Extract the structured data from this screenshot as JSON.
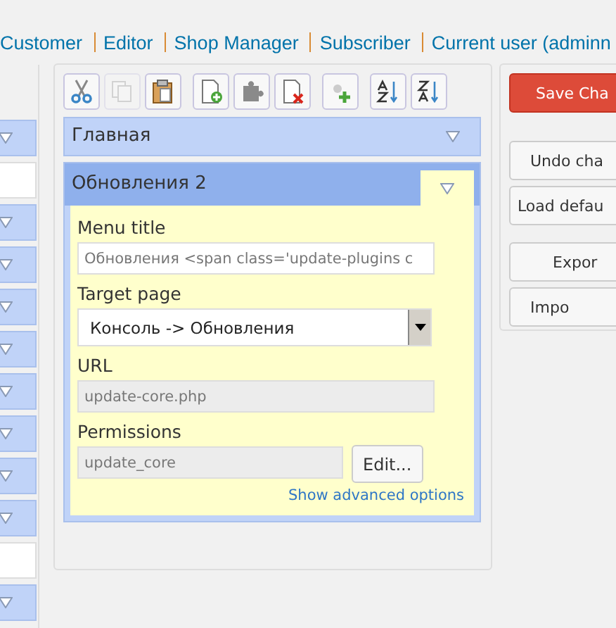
{
  "role_links": [
    {
      "label": "Customer"
    },
    {
      "label": "Editor"
    },
    {
      "label": "Shop Manager"
    },
    {
      "label": "Subscriber"
    },
    {
      "label": "Current user (adminn"
    }
  ],
  "left_menu": {
    "items": [
      {
        "kind": "menu"
      },
      {
        "kind": "separator"
      },
      {
        "kind": "menu"
      },
      {
        "kind": "menu"
      },
      {
        "kind": "menu"
      },
      {
        "kind": "menu"
      },
      {
        "kind": "menu"
      },
      {
        "kind": "menu"
      },
      {
        "kind": "menu"
      },
      {
        "kind": "menu"
      },
      {
        "kind": "separator"
      },
      {
        "kind": "menu"
      }
    ]
  },
  "toolbar": [
    {
      "kind": "cut",
      "disabled": false
    },
    {
      "kind": "copy",
      "disabled": true
    },
    {
      "kind": "paste",
      "disabled": false
    },
    {
      "kind": "new-menu",
      "disabled": false
    },
    {
      "kind": "plugin",
      "disabled": false
    },
    {
      "kind": "delete",
      "disabled": false
    },
    {
      "kind": "separator",
      "disabled": false
    },
    {
      "kind": "sort-asc",
      "disabled": false
    },
    {
      "kind": "sort-desc",
      "disabled": false
    }
  ],
  "menu_items": [
    {
      "title": "Главная",
      "expanded": false
    },
    {
      "title": "Обновления 2",
      "expanded": true,
      "fields": [
        {
          "kind": "text",
          "label": "Menu title",
          "value": "Обновления <span class='update-plugins c"
        },
        {
          "kind": "select",
          "label": "Target page",
          "value": "Консоль -> Обновления"
        },
        {
          "kind": "readonly",
          "label": "URL",
          "value": "update-core.php"
        },
        {
          "kind": "readonly-edit",
          "label": "Permissions",
          "value": "update_core",
          "button": "Edit..."
        }
      ],
      "advanced_link": "Show advanced options"
    }
  ],
  "actions": [
    {
      "label": "Save Cha",
      "kind": "primary"
    },
    {
      "label": "Undo cha",
      "kind": "normal"
    },
    {
      "label": "Load defau",
      "kind": "normal"
    },
    {
      "label": "Expor",
      "kind": "gap"
    },
    {
      "label": "Impo",
      "kind": "normal"
    }
  ]
}
